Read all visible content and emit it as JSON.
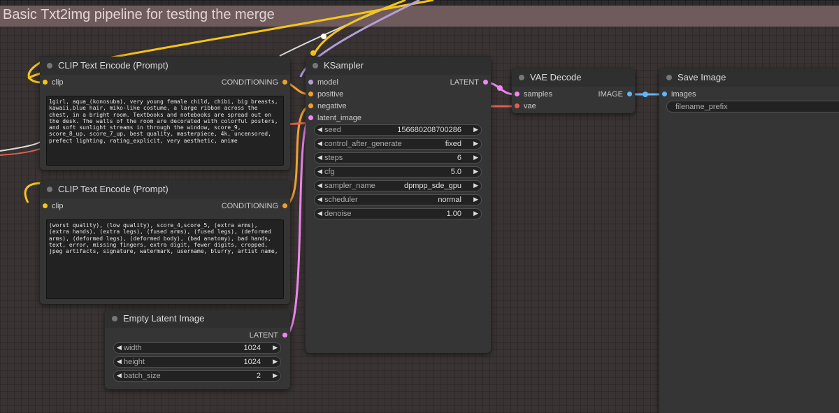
{
  "group": {
    "title": "Basic Txt2img pipeline for testing the merge"
  },
  "clip_positive": {
    "title": "CLIP Text Encode (Prompt)",
    "input_clip": "clip",
    "output": "CONDITIONING",
    "text": "1girl, aqua_(konosuba), very young female child, chibi, big breasts, kawaii,blue hair, miko-like costume, a large ribbon across the chest, in a bright room. Textbooks and notebooks are spread out on the desk. The walls of the room are decorated with colorful posters, and soft sunlight streams in through the window, score_9, score_8_up, score_7_up, best quality, masterpiece, 4k, uncensored, prefect lighting, rating_explicit, very aesthetic, anime"
  },
  "clip_negative": {
    "title": "CLIP Text Encode (Prompt)",
    "input_clip": "clip",
    "output": "CONDITIONING",
    "text": "(worst quality), (low quality), score_4,score_5, (extra arms), (extra hands), (extra legs), (fused arms), (fused legs), (deformed arms), (deformed legs), (deformed body), (bad anatomy), bad hands, text, error, missing fingers, extra digit, fewer digits, cropped, jpeg artifacts, signature, watermark, username, blurry, artist name,"
  },
  "empty_latent": {
    "title": "Empty Latent Image",
    "output": "LATENT",
    "widgets": [
      {
        "label": "width",
        "value": "1024"
      },
      {
        "label": "height",
        "value": "1024"
      },
      {
        "label": "batch_size",
        "value": "2"
      }
    ]
  },
  "ksampler": {
    "title": "KSampler",
    "inputs": [
      "model",
      "positive",
      "negative",
      "latent_image"
    ],
    "output": "LATENT",
    "widgets": [
      {
        "label": "seed",
        "value": "156680208700286"
      },
      {
        "label": "control_after_generate",
        "value": "fixed"
      },
      {
        "label": "steps",
        "value": "6"
      },
      {
        "label": "cfg",
        "value": "5.0"
      },
      {
        "label": "sampler_name",
        "value": "dpmpp_sde_gpu"
      },
      {
        "label": "scheduler",
        "value": "normal"
      },
      {
        "label": "denoise",
        "value": "1.00"
      }
    ]
  },
  "vae_decode": {
    "title": "VAE Decode",
    "inputs": [
      "samples",
      "vae"
    ],
    "output": "IMAGE"
  },
  "save_image": {
    "title": "Save Image",
    "input": "images",
    "filename_prefix": "filename_prefix"
  },
  "colors": {
    "clip": "#f5c518",
    "conditioning": "#f0a030",
    "latent": "#ee88ee",
    "model": "#b39ddb",
    "vae": "#e06050",
    "image": "#64b5f6"
  }
}
